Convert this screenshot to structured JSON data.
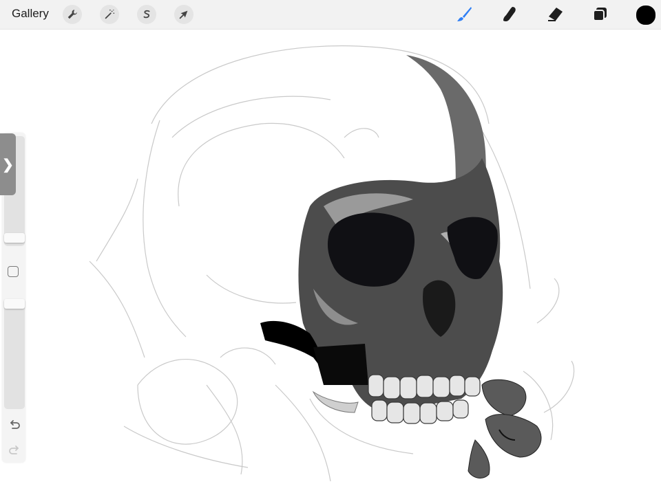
{
  "topbar": {
    "gallery_label": "Gallery",
    "actions_icon": "wrench-icon",
    "adjustments_icon": "magic-wand-icon",
    "selection_icon": "selection-s-icon",
    "transform_icon": "arrow-cursor-icon",
    "brush_icon": "brush-icon",
    "smudge_icon": "smudge-finger-icon",
    "eraser_icon": "eraser-icon",
    "layers_icon": "layers-icon",
    "current_color": "#000000",
    "active_tool_color": "#2f7ff5"
  },
  "sidebar": {
    "collapse_icon": "chevron-right-icon",
    "collapse_glyph": "❯",
    "undo_icon": "undo-arrow-icon",
    "redo_icon": "redo-arrow-icon"
  },
  "canvas": {
    "artwork": "skull-sketch"
  }
}
